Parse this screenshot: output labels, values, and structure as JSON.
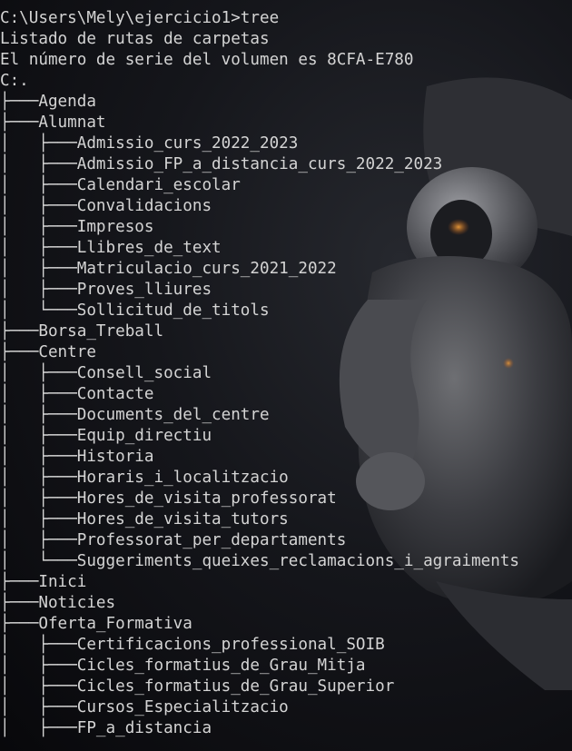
{
  "prompt": "C:\\Users\\Mely\\ejercicio1>tree",
  "header_lines": [
    "Listado de rutas de carpetas",
    "El número de serie del volumen es 8CFA-E780",
    "C:."
  ],
  "tree_lines": [
    "├───Agenda",
    "├───Alumnat",
    "│   ├───Admissio_curs_2022_2023",
    "│   ├───Admissio_FP_a_distancia_curs_2022_2023",
    "│   ├───Calendari_escolar",
    "│   ├───Convalidacions",
    "│   ├───Impresos",
    "│   ├───Llibres_de_text",
    "│   ├───Matriculacio_curs_2021_2022",
    "│   ├───Proves_lliures",
    "│   └───Sollicitud_de_titols",
    "├───Borsa_Treball",
    "├───Centre",
    "│   ├───Consell_social",
    "│   ├───Contacte",
    "│   ├───Documents_del_centre",
    "│   ├───Equip_directiu",
    "│   ├───Historia",
    "│   ├───Horaris_i_localitzacio",
    "│   ├───Hores_de_visita_professorat",
    "│   ├───Hores_de_visita_tutors",
    "│   ├───Professorat_per_departaments",
    "│   └───Suggeriments_queixes_reclamacions_i_agraiments",
    "├───Inici",
    "├───Noticies",
    "├───Oferta_Formativa",
    "│   ├───Certificacions_professional_SOIB",
    "│   ├───Cicles_formatius_de_Grau_Mitja",
    "│   ├───Cicles_formatius_de_Grau_Superior",
    "│   ├───Cursos_Especialitzacio",
    "│   ├───FP_a_distancia"
  ],
  "colors": {
    "text": "#d4d4d4",
    "background": "#0c0c10"
  },
  "wallpaper": "astronaut-background"
}
